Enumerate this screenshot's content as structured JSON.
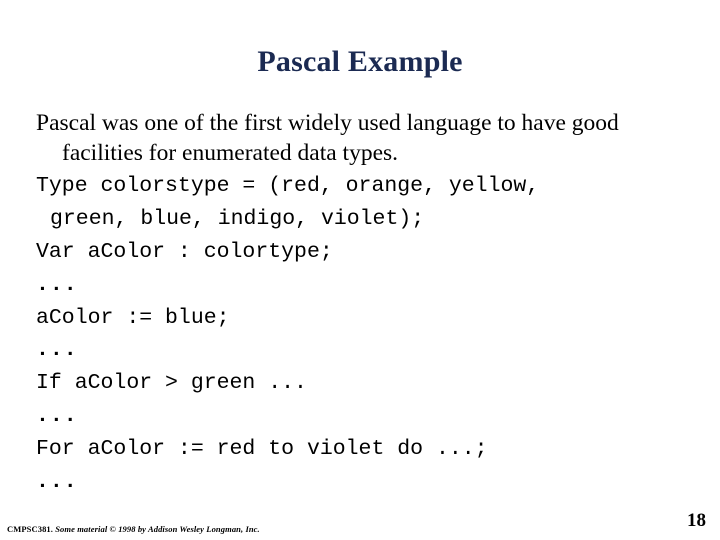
{
  "slide": {
    "title": "Pascal Example",
    "title_color": "#1b2a52",
    "body_paragraph": "Pascal was one of the first widely used language to have good facilities for enumerated data types.",
    "code_lines": [
      {
        "text": "Type colorstype = (red, orange, yellow,",
        "style": "normal"
      },
      {
        "text": "green, blue, indigo, violet);",
        "style": "wrapped"
      },
      {
        "text": "Var aColor : colortype;",
        "style": "normal"
      },
      {
        "text": "...",
        "style": "ellipsis"
      },
      {
        "text": "aColor := blue;",
        "style": "normal"
      },
      {
        "text": "...",
        "style": "ellipsis"
      },
      {
        "text": "If aColor > green ...",
        "style": "normal"
      },
      {
        "text": "...",
        "style": "ellipsis"
      },
      {
        "text": "For aColor := red to violet do ...;",
        "style": "normal"
      },
      {
        "text": "...",
        "style": "ellipsis"
      }
    ],
    "footer": {
      "course": "CMPSC381.",
      "credit": "Some material © 1998 by Addison Wesley Longman, Inc."
    },
    "page_number": "18"
  }
}
